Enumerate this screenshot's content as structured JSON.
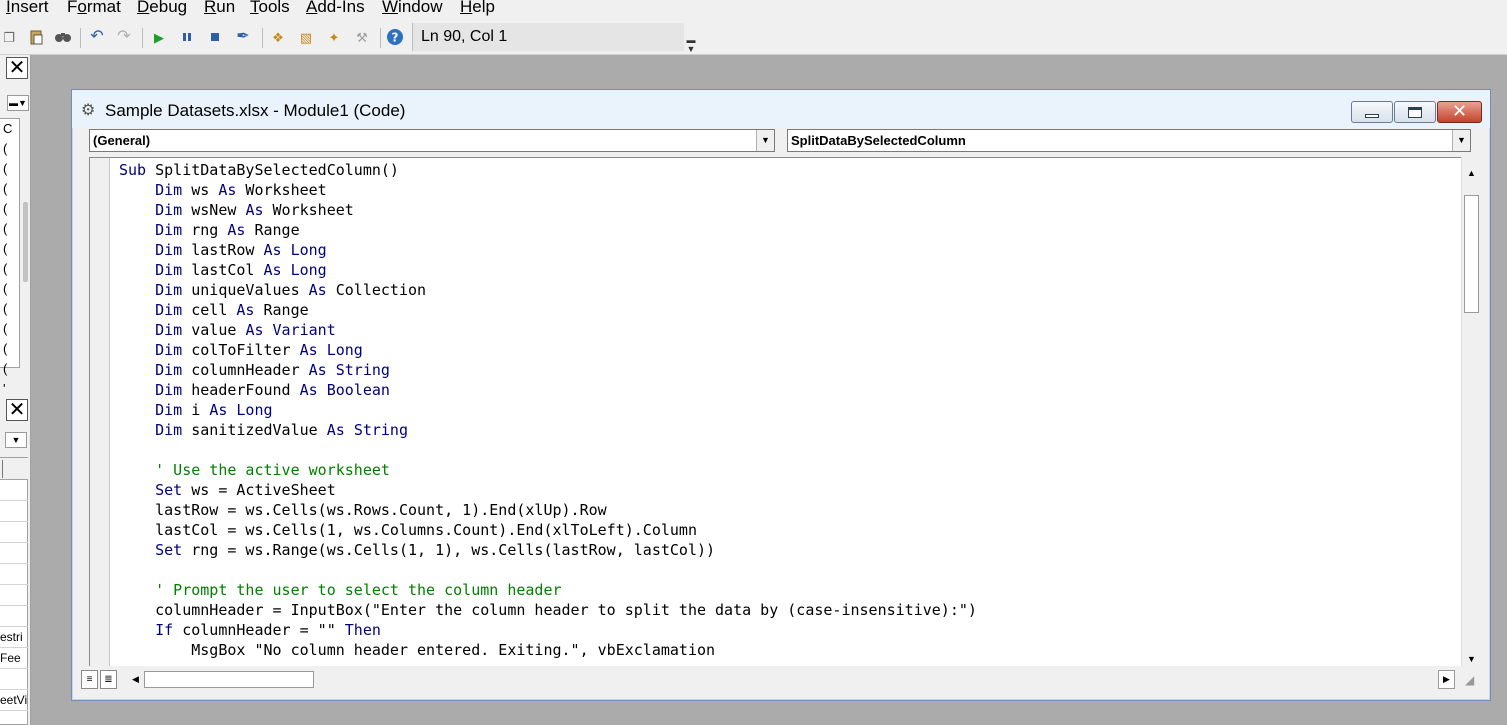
{
  "menu": {
    "items": [
      {
        "label": "Insert",
        "u": "I",
        "rest": "nsert"
      },
      {
        "label": "Format",
        "u": "o"
      },
      {
        "label": "Debug",
        "u": "D"
      },
      {
        "label": "Run",
        "u": "R"
      },
      {
        "label": "Tools",
        "u": "T"
      },
      {
        "label": "Add-Ins",
        "u": "A"
      },
      {
        "label": "Window",
        "u": "W"
      },
      {
        "label": "Help",
        "u": "H"
      }
    ]
  },
  "toolbar": {
    "status": "Ln 90, Col 1",
    "icons": [
      "copy-icon",
      "paste-icon",
      "find-icon",
      "undo-icon",
      "redo-icon",
      "run-icon",
      "break-icon",
      "reset-icon",
      "design-mode-icon",
      "project-explorer-icon",
      "properties-window-icon",
      "object-browser-icon",
      "toolbox-icon",
      "help-icon"
    ]
  },
  "left_panel": {
    "tree_rows": [
      "C",
      "(",
      "(",
      "(",
      "(",
      "(",
      "(",
      "(",
      "(",
      "(",
      "(",
      "(",
      "(",
      "'"
    ],
    "prop_rows": [
      "estri",
      " Fee",
      "eetVi"
    ]
  },
  "code_window": {
    "title": "Sample Datasets.xlsx - Module1 (Code)",
    "object_combo": "(General)",
    "procedure_combo": "SplitDataBySelectedColumn",
    "code_lines": [
      [
        {
          "t": "Sub",
          "c": "kw"
        },
        {
          "t": " SplitDataBySelectedColumn()"
        }
      ],
      [
        {
          "t": "    "
        },
        {
          "t": "Dim",
          "c": "kw"
        },
        {
          "t": " ws "
        },
        {
          "t": "As",
          "c": "kw"
        },
        {
          "t": " Worksheet"
        }
      ],
      [
        {
          "t": "    "
        },
        {
          "t": "Dim",
          "c": "kw"
        },
        {
          "t": " wsNew "
        },
        {
          "t": "As",
          "c": "kw"
        },
        {
          "t": " Worksheet"
        }
      ],
      [
        {
          "t": "    "
        },
        {
          "t": "Dim",
          "c": "kw"
        },
        {
          "t": " rng "
        },
        {
          "t": "As",
          "c": "kw"
        },
        {
          "t": " Range"
        }
      ],
      [
        {
          "t": "    "
        },
        {
          "t": "Dim",
          "c": "kw"
        },
        {
          "t": " lastRow "
        },
        {
          "t": "As",
          "c": "kw"
        },
        {
          "t": " "
        },
        {
          "t": "Long",
          "c": "kw"
        }
      ],
      [
        {
          "t": "    "
        },
        {
          "t": "Dim",
          "c": "kw"
        },
        {
          "t": " lastCol "
        },
        {
          "t": "As",
          "c": "kw"
        },
        {
          "t": " "
        },
        {
          "t": "Long",
          "c": "kw"
        }
      ],
      [
        {
          "t": "    "
        },
        {
          "t": "Dim",
          "c": "kw"
        },
        {
          "t": " uniqueValues "
        },
        {
          "t": "As",
          "c": "kw"
        },
        {
          "t": " Collection"
        }
      ],
      [
        {
          "t": "    "
        },
        {
          "t": "Dim",
          "c": "kw"
        },
        {
          "t": " cell "
        },
        {
          "t": "As",
          "c": "kw"
        },
        {
          "t": " Range"
        }
      ],
      [
        {
          "t": "    "
        },
        {
          "t": "Dim",
          "c": "kw"
        },
        {
          "t": " value "
        },
        {
          "t": "As",
          "c": "kw"
        },
        {
          "t": " "
        },
        {
          "t": "Variant",
          "c": "kw"
        }
      ],
      [
        {
          "t": "    "
        },
        {
          "t": "Dim",
          "c": "kw"
        },
        {
          "t": " colToFilter "
        },
        {
          "t": "As",
          "c": "kw"
        },
        {
          "t": " "
        },
        {
          "t": "Long",
          "c": "kw"
        }
      ],
      [
        {
          "t": "    "
        },
        {
          "t": "Dim",
          "c": "kw"
        },
        {
          "t": " columnHeader "
        },
        {
          "t": "As",
          "c": "kw"
        },
        {
          "t": " "
        },
        {
          "t": "String",
          "c": "kw"
        }
      ],
      [
        {
          "t": "    "
        },
        {
          "t": "Dim",
          "c": "kw"
        },
        {
          "t": " headerFound "
        },
        {
          "t": "As",
          "c": "kw"
        },
        {
          "t": " "
        },
        {
          "t": "Boolean",
          "c": "kw"
        }
      ],
      [
        {
          "t": "    "
        },
        {
          "t": "Dim",
          "c": "kw"
        },
        {
          "t": " i "
        },
        {
          "t": "As",
          "c": "kw"
        },
        {
          "t": " "
        },
        {
          "t": "Long",
          "c": "kw"
        }
      ],
      [
        {
          "t": "    "
        },
        {
          "t": "Dim",
          "c": "kw"
        },
        {
          "t": " sanitizedValue "
        },
        {
          "t": "As",
          "c": "kw"
        },
        {
          "t": " "
        },
        {
          "t": "String",
          "c": "kw"
        }
      ],
      [],
      [
        {
          "t": "    "
        },
        {
          "t": "' Use the active worksheet",
          "c": "cm"
        }
      ],
      [
        {
          "t": "    "
        },
        {
          "t": "Set",
          "c": "kw"
        },
        {
          "t": " ws = ActiveSheet"
        }
      ],
      [
        {
          "t": "    lastRow = ws.Cells(ws.Rows.Count, 1).End(xlUp).Row"
        }
      ],
      [
        {
          "t": "    lastCol = ws.Cells(1, ws.Columns.Count).End(xlToLeft).Column"
        }
      ],
      [
        {
          "t": "    "
        },
        {
          "t": "Set",
          "c": "kw"
        },
        {
          "t": " rng = ws.Range(ws.Cells(1, 1), ws.Cells(lastRow, lastCol))"
        }
      ],
      [],
      [
        {
          "t": "    "
        },
        {
          "t": "' Prompt the user to select the column header",
          "c": "cm"
        }
      ],
      [
        {
          "t": "    columnHeader = InputBox(\"Enter the column header to split the data by (case-insensitive):\")"
        }
      ],
      [
        {
          "t": "    "
        },
        {
          "t": "If",
          "c": "kw"
        },
        {
          "t": " columnHeader = \"\" "
        },
        {
          "t": "Then",
          "c": "kw"
        }
      ],
      [
        {
          "t": "        MsgBox \"No column header entered. Exiting.\", vbExclamation"
        }
      ]
    ]
  },
  "colors": {
    "keyword": "#00007f",
    "comment": "#007f00",
    "title_bar": "#eaf2fb",
    "close_button": "#c4432b"
  }
}
